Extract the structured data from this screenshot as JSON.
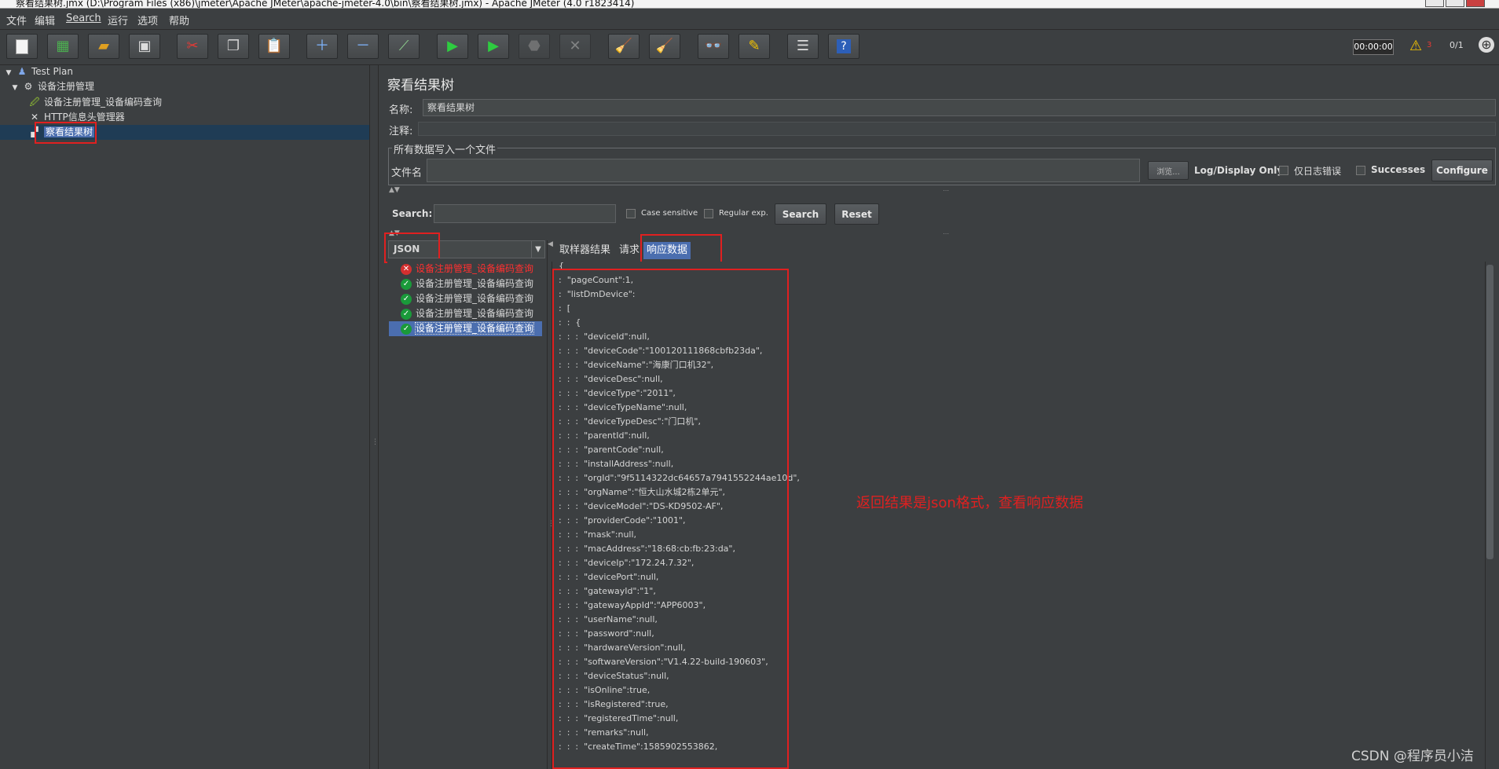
{
  "window": {
    "title": "察看结果树.jmx (D:\\Program Files (x86)\\jmeter\\Apache JMeter\\apache-jmeter-4.0\\bin\\察看结果树.jmx) - Apache JMeter (4.0 r1823414)"
  },
  "menu": [
    "文件",
    "编辑",
    "Search",
    "运行",
    "选项",
    "帮助"
  ],
  "toolbar": {
    "timer": "00:00:00",
    "warn_count": "3",
    "threads": "0/1"
  },
  "tree": {
    "items": [
      {
        "label": "Test Plan"
      },
      {
        "label": "设备注册管理"
      },
      {
        "label": "设备注册管理_设备编码查询"
      },
      {
        "label": "HTTP信息头管理器"
      },
      {
        "label": "察看结果树"
      }
    ]
  },
  "panel": {
    "title": "察看结果树",
    "name_label": "名称:",
    "name_value": "察看结果树",
    "comment_label": "注释:",
    "comment_value": "",
    "file_group_title": "所有数据写入一个文件",
    "file_label": "文件名",
    "file_value": "",
    "browse_label": "浏览...",
    "log_display_label": "Log/Display Only:",
    "errors_only_label": "仅日志错误",
    "successes_label": "Successes",
    "configure_label": "Configure"
  },
  "search": {
    "label": "Search:",
    "value": "",
    "case_sensitive_label": "Case sensitive",
    "regex_label": "Regular exp.",
    "search_button": "Search",
    "reset_button": "Reset"
  },
  "renderer": {
    "selected": "JSON"
  },
  "results": [
    {
      "label": "设备注册管理_设备编码查询",
      "status": "error"
    },
    {
      "label": "设备注册管理_设备编码查询",
      "status": "success"
    },
    {
      "label": "设备注册管理_设备编码查询",
      "status": "success"
    },
    {
      "label": "设备注册管理_设备编码查询",
      "status": "success"
    },
    {
      "label": "设备注册管理_设备编码查询",
      "status": "success-selected"
    }
  ],
  "tabs": [
    "取样器结果",
    "请求",
    "响应数据"
  ],
  "json_lines": [
    "{",
    ":  \"pageCount\":1,",
    ":  \"listDmDevice\":",
    ":  [",
    ":  :  {",
    ":  :  :  \"deviceId\":null,",
    ":  :  :  \"deviceCode\":\"100120111868cbfb23da\",",
    ":  :  :  \"deviceName\":\"海康门口机32\",",
    ":  :  :  \"deviceDesc\":null,",
    ":  :  :  \"deviceType\":\"2011\",",
    ":  :  :  \"deviceTypeName\":null,",
    ":  :  :  \"deviceTypeDesc\":\"门口机\",",
    ":  :  :  \"parentId\":null,",
    ":  :  :  \"parentCode\":null,",
    ":  :  :  \"installAddress\":null,",
    ":  :  :  \"orgId\":\"9f5114322dc64657a7941552244ae10d\",",
    ":  :  :  \"orgName\":\"恒大山水城2栋2单元\",",
    ":  :  :  \"deviceModel\":\"DS-KD9502-AF\",",
    ":  :  :  \"providerCode\":\"1001\",",
    ":  :  :  \"mask\":null,",
    ":  :  :  \"macAddress\":\"18:68:cb:fb:23:da\",",
    ":  :  :  \"deviceIp\":\"172.24.7.32\",",
    ":  :  :  \"devicePort\":null,",
    ":  :  :  \"gatewayId\":\"1\",",
    ":  :  :  \"gatewayAppId\":\"APP6003\",",
    ":  :  :  \"userName\":null,",
    ":  :  :  \"password\":null,",
    ":  :  :  \"hardwareVersion\":null,",
    ":  :  :  \"softwareVersion\":\"V1.4.22-build-190603\",",
    ":  :  :  \"deviceStatus\":null,",
    ":  :  :  \"isOnline\":true,",
    ":  :  :  \"isRegistered\":true,",
    ":  :  :  \"registeredTime\":null,",
    ":  :  :  \"remarks\":null,",
    ":  :  :  \"createTime\":1585902553862,"
  ],
  "annotation": "返回结果是json格式，查看响应数据",
  "watermark": "CSDN @程序员小洁",
  "colors": {
    "background": "#3c3f41",
    "annotation_red": "#e02020",
    "selection_blue": "#4b6eaf",
    "error_red": "#ff3030",
    "success_green": "#1a9a3a"
  }
}
